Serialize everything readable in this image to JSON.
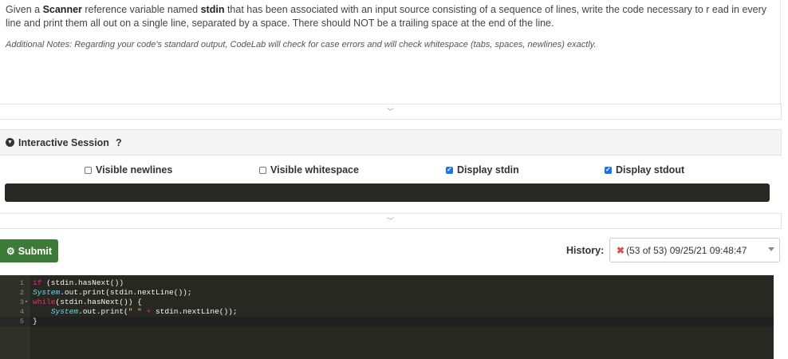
{
  "prompt": {
    "p1": "Given a ",
    "b1": "Scanner",
    "p2": " reference variable named ",
    "b2": "stdin",
    "p3": " that has been associated with an input source consisting of a sequence of lines, write the code necessary to r ead in every line and print them all out on a single line, separated by a space. There should NOT be a trailing space at the end of the line.",
    "notes": "Additional Notes: Regarding your code's standard output, CodeLab will check for case errors and will check whitespace (tabs, spaces, newlines) exactly."
  },
  "icons": {
    "collapse": "double-chevron-down-icon",
    "session_toggle": "chevron-circle-down-icon",
    "submit": "gear-icon",
    "history_status": "x-error-icon",
    "dropdown": "caret-down-icon"
  },
  "session": {
    "title": "Interactive Session",
    "help": "?",
    "options": [
      {
        "label": "Visible newlines",
        "checked": false
      },
      {
        "label": "Visible whitespace",
        "checked": false
      },
      {
        "label": "Display stdin",
        "checked": true
      },
      {
        "label": "Display stdout",
        "checked": true
      }
    ]
  },
  "submit": {
    "label": "Submit"
  },
  "history": {
    "label": "History:",
    "selected": "(53 of 53) 09/25/21 09:48:47"
  },
  "editor": {
    "line_numbers": [
      "1",
      "2",
      "3",
      "4",
      "5"
    ],
    "lines": [
      [
        {
          "t": "if",
          "c": "kw"
        },
        {
          "t": " (stdin.hasNext())",
          "c": ""
        }
      ],
      [
        {
          "t": "System",
          "c": "ty"
        },
        {
          "t": ".out.print(stdin.nextLine());",
          "c": ""
        }
      ],
      [
        {
          "t": "while",
          "c": "kw"
        },
        {
          "t": "(stdin.hasNext()) {",
          "c": ""
        }
      ],
      [
        {
          "t": "    ",
          "c": ""
        },
        {
          "t": "System",
          "c": "ty"
        },
        {
          "t": ".out.print(",
          "c": ""
        },
        {
          "t": "\" \"",
          "c": "str"
        },
        {
          "t": " + ",
          "c": "kw"
        },
        {
          "t": "stdin.nextLine());",
          "c": ""
        }
      ],
      [
        {
          "t": "}",
          "c": ""
        }
      ]
    ]
  },
  "colors": {
    "submit_bg": "#3c7b37",
    "editor_bg": "#272822",
    "error": "#d9534f",
    "checkbox_on": "#1a73e8"
  }
}
